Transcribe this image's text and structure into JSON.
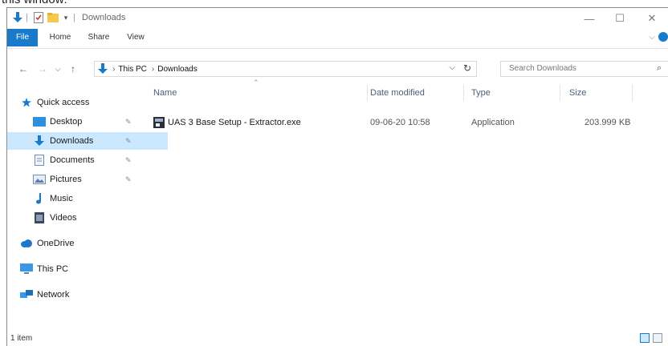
{
  "titlebar": {
    "title": "Downloads",
    "controls": {
      "minimize": "—",
      "maximize": "☐",
      "close": "✕"
    }
  },
  "ribbon": {
    "tabs": [
      "File",
      "Home",
      "Share",
      "View"
    ],
    "expand_glyph": "⌵"
  },
  "address": {
    "crumbs": [
      "This PC",
      "Downloads"
    ],
    "separator": "›",
    "refresh_glyph": "↻",
    "dropdown_glyph": "⌵",
    "search_placeholder": "Search Downloads"
  },
  "navigation": {
    "back": "←",
    "forward": "→",
    "recent": "⌵",
    "up": "↑"
  },
  "nav_pane": {
    "items": [
      {
        "label": "Quick access",
        "icon": "star-icon"
      },
      {
        "label": "Desktop",
        "icon": "desktop-folder-icon",
        "pinned": true
      },
      {
        "label": "Downloads",
        "icon": "download-arrow-icon",
        "pinned": true,
        "selected": true
      },
      {
        "label": "Documents",
        "icon": "document-icon",
        "pinned": true
      },
      {
        "label": "Pictures",
        "icon": "pictures-icon",
        "pinned": true
      },
      {
        "label": "Music",
        "icon": "music-note-icon"
      },
      {
        "label": "Videos",
        "icon": "video-icon"
      },
      {
        "label": "OneDrive",
        "icon": "cloud-icon"
      },
      {
        "label": "This PC",
        "icon": "computer-icon"
      },
      {
        "label": "Network",
        "icon": "network-icon"
      }
    ]
  },
  "file_list": {
    "columns": [
      "Name",
      "Date modified",
      "Type",
      "Size"
    ],
    "rows": [
      {
        "name": "UAS 3 Base Setup - Extractor.exe",
        "date_modified": "09-06-20 10:58",
        "type": "Application",
        "size": "203.999 KB"
      }
    ]
  },
  "status": {
    "item_count": "1 item"
  },
  "caption": "this window:",
  "colors": {
    "accent": "#1979ca",
    "selection": "#cce8ff",
    "header_text": "#4c607a"
  }
}
